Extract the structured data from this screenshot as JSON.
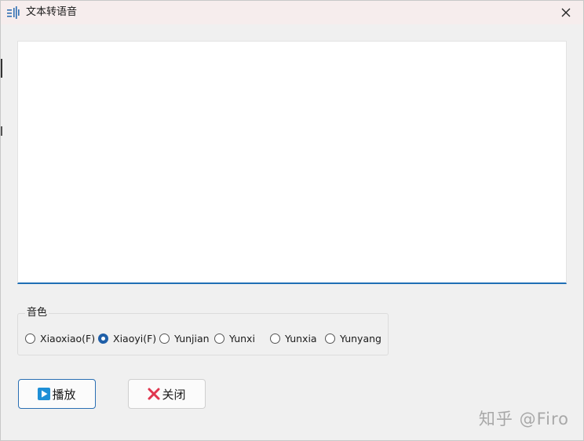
{
  "window": {
    "title": "文本转语音",
    "icon": "sound-wave-icon"
  },
  "text_input": {
    "value": "",
    "placeholder": ""
  },
  "voice": {
    "group_label": "音色",
    "options": [
      {
        "label": "Xiaoxiao(F)",
        "checked": false
      },
      {
        "label": "Xiaoyi(F)",
        "checked": true
      },
      {
        "label": "Yunjian",
        "checked": false
      },
      {
        "label": "Yunxi",
        "checked": false
      },
      {
        "label": "Yunxia",
        "checked": false
      },
      {
        "label": "Yunyang",
        "checked": false
      }
    ]
  },
  "buttons": {
    "play_label": "播放",
    "play_icon": "play-icon",
    "close_label": "关闭",
    "close_icon": "red-x-icon"
  },
  "watermark": "知乎 @Firo",
  "colors": {
    "accent": "#1f5fa8",
    "close_red": "#e0364f"
  }
}
